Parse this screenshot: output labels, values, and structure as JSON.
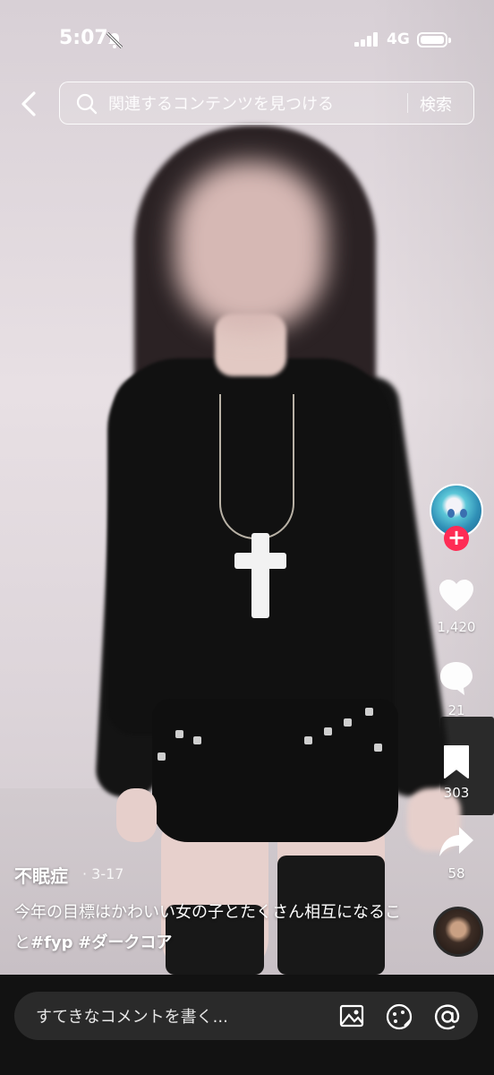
{
  "status_bar": {
    "time": "5:07",
    "network": "4G"
  },
  "search": {
    "placeholder": "関連するコンテンツを見つける",
    "button_label": "検索"
  },
  "rail": {
    "likes": "1,420",
    "comments": "21",
    "saves": "303",
    "shares": "58"
  },
  "post": {
    "author": "不眠症",
    "date": "· 3-17",
    "caption_text": "今年の目標はかわいい女の子とたくさん相互になること",
    "hashtags": [
      "#fyp",
      "#ダークコア"
    ]
  },
  "comment_bar": {
    "placeholder": "すてきなコメントを書く..."
  },
  "colors": {
    "accent": "#fe2c55",
    "bar_bg": "#121212",
    "input_bg": "#2a2a2a"
  },
  "icons": [
    "back-arrow-icon",
    "search-icon",
    "heart-icon",
    "comment-bubble-icon",
    "bookmark-icon",
    "share-arrow-icon",
    "image-icon",
    "emoji-icon",
    "at-mention-icon",
    "bell-muted-icon",
    "signal-icon",
    "battery-icon"
  ]
}
